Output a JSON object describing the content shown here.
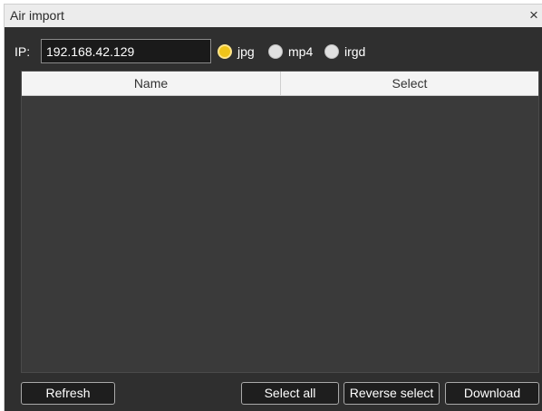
{
  "window": {
    "title": "Air import",
    "close_glyph": "×"
  },
  "connection": {
    "ip_label": "IP:",
    "ip_value": "192.168.42.129"
  },
  "format_options": [
    {
      "label": "jpg",
      "checked": true
    },
    {
      "label": "mp4",
      "checked": false
    },
    {
      "label": "irgd",
      "checked": false
    }
  ],
  "file_table": {
    "columns": [
      "Name",
      "Select"
    ],
    "rows": []
  },
  "actions": {
    "refresh_label": "Refresh",
    "select_all_label": "Select all",
    "reverse_select_label": "Reverse select",
    "download_label": "Download"
  },
  "colors": {
    "panel_background": "#2f2f2f",
    "selected_radio": "#f0c419",
    "button_background": "#1e1e1e"
  }
}
